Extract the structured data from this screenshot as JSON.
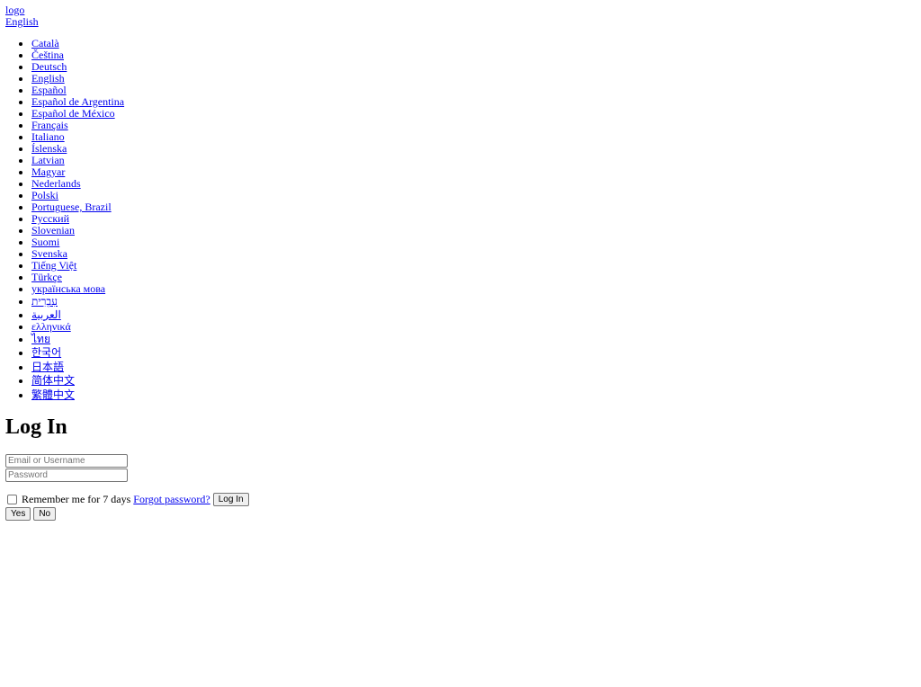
{
  "header": {
    "logo_alt": "logo",
    "current_language": "English"
  },
  "languages": [
    "Català",
    "Čeština",
    "Deutsch",
    "English",
    "Español",
    "Español de Argentina",
    "Español de México",
    "Français",
    "Italiano",
    "Íslenska",
    "Latvian",
    "Magyar",
    "Nederlands",
    "Polski",
    "Portuguese, Brazil",
    "Русский",
    "Slovenian",
    "Suomi",
    "Svenska",
    "Tiếng Việt",
    "Türkçe",
    "українська мова",
    "עִבְרִית",
    "العربية",
    "ελληνικά",
    "ไทย",
    "한국어",
    "日本語",
    "简体中文",
    "繁體中文"
  ],
  "login": {
    "title": "Log In",
    "username_placeholder": "Email or Username",
    "password_placeholder": "Password",
    "remember_label": "Remember me for 7 days",
    "forgot_link": "Forgot password?",
    "submit_label": "Log In"
  },
  "confirm": {
    "yes_label": "Yes",
    "no_label": "No"
  },
  "colors": {
    "link": "#0000ee",
    "text": "#000000",
    "background": "#ffffff"
  }
}
